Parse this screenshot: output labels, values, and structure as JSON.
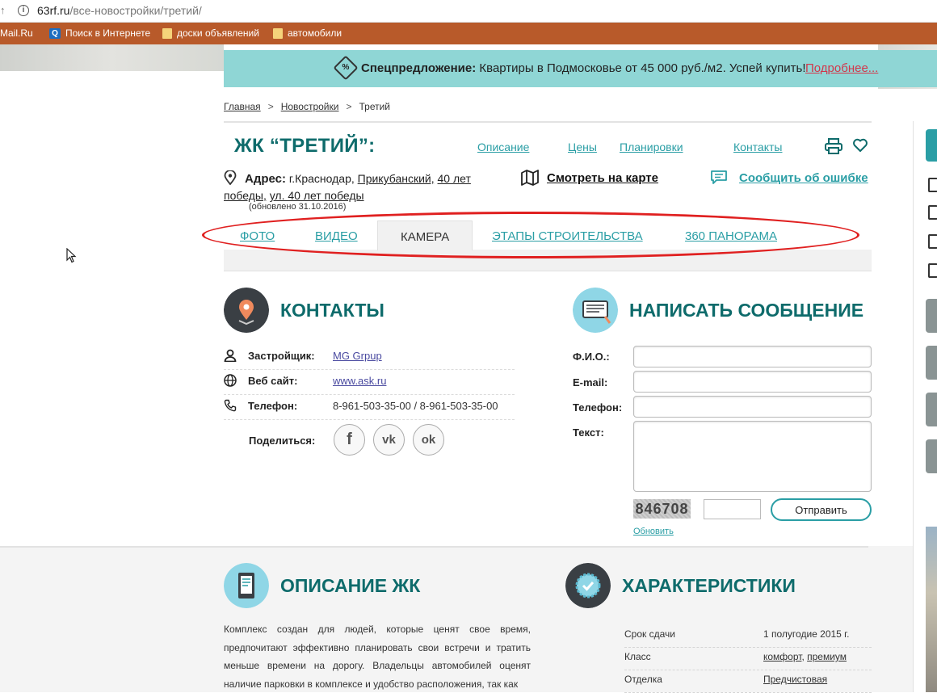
{
  "browser": {
    "url_host": "63rf.ru",
    "url_path": "/все-новостройки/третий/",
    "bookmarks": [
      "Mail.Ru",
      "Поиск в Интернете",
      "доски объявлений",
      "автомобили"
    ]
  },
  "promo": {
    "bold": "Спецпредложение:",
    "text": " Квартиры в Подмосковье от 45 000 руб./м2. Успей купить!",
    "more": "Подробнее...",
    "icon": "percent-tag-icon",
    "bg_color": "#8fd6d5"
  },
  "breadcrumb": {
    "items": [
      "Главная",
      "Новостройки",
      "Третий"
    ],
    "separator": ">"
  },
  "header": {
    "title": "ЖК “ТРЕТИЙ”:",
    "nav": [
      "Описание",
      "Цены",
      "Планировки",
      "Контакты"
    ],
    "address_label": "Адрес:",
    "address_city": "г.Краснодар,",
    "address_district": "Прикубанский,",
    "address_street1": "40 лет победы,",
    "address_street2": "ул. 40 лет победы",
    "updated": "(обновлено 31.10.2016)",
    "map_link": "Смотреть на карте",
    "error_link": "Сообщить об ошибке",
    "accent_color": "#2a9ea5",
    "title_color": "#0e6b6b"
  },
  "tabs": {
    "items": [
      "ФОТО",
      "ВИДЕО",
      "КАМЕРА",
      "ЭТАПЫ СТРОИТЕЛЬСТВА",
      "360 ПАНОРАМА"
    ],
    "active": "КАМЕРА",
    "highlight_color": "#e02020"
  },
  "contacts": {
    "title": "КОНТАКТЫ",
    "developer_label": "Застройщик:",
    "developer_value": "MG Grpup",
    "site_label": "Веб сайт:",
    "site_value": "www.ask.ru",
    "phone_label": "Телефон:",
    "phone_value": "8-961-503-35-00 / 8-961-503-35-00",
    "share_label": "Поделиться:",
    "social": [
      "f",
      "vk",
      "ok"
    ]
  },
  "message_form": {
    "title": "НАПИСАТЬ СООБЩЕНИЕ",
    "name_label": "Ф.И.О.:",
    "email_label": "E-mail:",
    "phone_label": "Телефон:",
    "text_label": "Текст:",
    "captcha": "846708",
    "send_button": "Отправить",
    "refresh": "Обновить"
  },
  "description": {
    "title": "ОПИСАНИЕ ЖК",
    "text": "Комплекс создан для людей, которые ценят свое время, предпочитают эффективно планировать свои встречи и тратить меньше времени на дорогу. Владельцы автомобилей оценят наличие парковки в комплексе и удобство расположения, так как"
  },
  "characteristics": {
    "title": "ХАРАКТЕРИСТИКИ",
    "deadline_label": "Срок сдачи",
    "deadline_value": "1 полугодие 2015 г.",
    "class_label": "Класс",
    "class_value1": "комфорт",
    "class_sep": ", ",
    "class_value2": "премиум",
    "finish_label": "Отделка",
    "finish_value": "Предчистовая"
  }
}
